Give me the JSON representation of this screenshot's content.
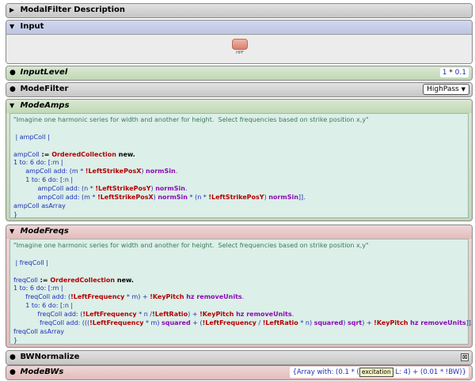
{
  "panels": {
    "description": {
      "title": "ModalFilter Description"
    },
    "input": {
      "title": "Input",
      "node_label": "HPF"
    },
    "input_level": {
      "title": "InputLevel",
      "value_a": "1",
      "op": "*",
      "value_b": "0.1"
    },
    "mode_filter": {
      "title": "ModeFilter",
      "selected": "HighPass"
    },
    "mode_amps": {
      "title": "ModeAmps",
      "lines": [
        [
          {
            "t": "\"Imagine one harmonic series for width and another for height.  Select frequencies based on strike position x,y\"",
            "c": "cmt"
          }
        ],
        [],
        [
          {
            "t": " | ampColl |",
            "c": "blue"
          }
        ],
        [],
        [
          {
            "t": "ampColl",
            "c": "blue"
          },
          {
            "t": " := ",
            "c": "black"
          },
          {
            "t": "OrderedCollection",
            "c": "red"
          },
          {
            "t": " new.",
            "c": "black"
          }
        ],
        [
          {
            "t": "1 to: 6 do: [",
            "c": "blue"
          },
          {
            "t": ":m",
            "c": "blue"
          },
          {
            "t": " |",
            "c": "blue"
          }
        ],
        [
          {
            "t": "      ampColl add: (m * ",
            "c": "blue"
          },
          {
            "t": "!LeftStrikePosX",
            "c": "red"
          },
          {
            "t": ") ",
            "c": "blue"
          },
          {
            "t": "normSin",
            "c": "purple"
          },
          {
            "t": ".",
            "c": "blue"
          }
        ],
        [
          {
            "t": "      1 to: 6 do: [:n |",
            "c": "blue"
          }
        ],
        [
          {
            "t": "            ampColl add: (n * ",
            "c": "blue"
          },
          {
            "t": "!LeftStrikePosY",
            "c": "red"
          },
          {
            "t": ") ",
            "c": "blue"
          },
          {
            "t": "normSin",
            "c": "purple"
          },
          {
            "t": ".",
            "c": "blue"
          }
        ],
        [
          {
            "t": "            ampColl add: (m * ",
            "c": "blue"
          },
          {
            "t": "!LeftStrikePosX",
            "c": "red"
          },
          {
            "t": ") ",
            "c": "blue"
          },
          {
            "t": "normSin",
            "c": "purple"
          },
          {
            "t": " * (n * ",
            "c": "blue"
          },
          {
            "t": "!LeftStrikePosY",
            "c": "red"
          },
          {
            "t": ") ",
            "c": "blue"
          },
          {
            "t": "normSin",
            "c": "purple"
          },
          {
            "t": "]].",
            "c": "blue"
          }
        ],
        [
          {
            "t": "ampColl asArray",
            "c": "blue"
          }
        ],
        [
          {
            "t": "}",
            "c": "blue"
          }
        ]
      ]
    },
    "mode_freqs": {
      "title": "ModeFreqs",
      "lines": [
        [
          {
            "t": "\"Imagine one harmonic series for width and another for height.  Select frequencies based on strike position x,y\"",
            "c": "cmt"
          }
        ],
        [],
        [
          {
            "t": " | freqColl |",
            "c": "blue"
          }
        ],
        [],
        [
          {
            "t": "freqColl",
            "c": "blue"
          },
          {
            "t": " := ",
            "c": "black"
          },
          {
            "t": "OrderedCollection",
            "c": "red"
          },
          {
            "t": " new.",
            "c": "black"
          }
        ],
        [
          {
            "t": "1 to: 6 do: [:m |",
            "c": "blue"
          }
        ],
        [
          {
            "t": "      freqColl add: (",
            "c": "blue"
          },
          {
            "t": "!LeftFrequency",
            "c": "red"
          },
          {
            "t": " * m) + ",
            "c": "blue"
          },
          {
            "t": "!KeyPitch",
            "c": "red"
          },
          {
            "t": " hz removeUnits",
            "c": "purple"
          },
          {
            "t": ".",
            "c": "blue"
          }
        ],
        [
          {
            "t": "      1 to: 6 do: [:n |",
            "c": "blue"
          }
        ],
        [
          {
            "t": "            freqColl add: (",
            "c": "blue"
          },
          {
            "t": "!LeftFrequency",
            "c": "red"
          },
          {
            "t": " * n /",
            "c": "blue"
          },
          {
            "t": "!LeftRatio",
            "c": "red"
          },
          {
            "t": ") + ",
            "c": "blue"
          },
          {
            "t": "!KeyPitch",
            "c": "red"
          },
          {
            "t": " hz removeUnits",
            "c": "purple"
          },
          {
            "t": ".",
            "c": "blue"
          }
        ],
        [
          {
            "t": "             freqColl add: (((",
            "c": "blue"
          },
          {
            "t": "!LeftFrequency",
            "c": "red"
          },
          {
            "t": " * m) ",
            "c": "blue"
          },
          {
            "t": "squared",
            "c": "purple"
          },
          {
            "t": " + (",
            "c": "blue"
          },
          {
            "t": "!LeftFrequency",
            "c": "red"
          },
          {
            "t": " / ",
            "c": "blue"
          },
          {
            "t": "!LeftRatio",
            "c": "red"
          },
          {
            "t": " * n) ",
            "c": "blue"
          },
          {
            "t": "squared",
            "c": "purple"
          },
          {
            "t": ") ",
            "c": "blue"
          },
          {
            "t": "sqrt",
            "c": "purple"
          },
          {
            "t": ") + ",
            "c": "blue"
          },
          {
            "t": "!KeyPitch",
            "c": "red"
          },
          {
            "t": " hz removeUnits",
            "c": "purple"
          },
          {
            "t": "]].",
            "c": "blue"
          }
        ],
        [
          {
            "t": "freqColl asArray",
            "c": "blue"
          }
        ],
        [
          {
            "t": "}",
            "c": "blue"
          }
        ]
      ]
    },
    "bw_normalize": {
      "title": "BWNormalize",
      "checkbox": "⊠"
    },
    "mode_bws": {
      "title": "ModeBWs",
      "expr_prefix": "{Array with: (0.1 * (",
      "badge": "excitation",
      "expr_suffix": " L: 4) + (0.01 * !BW)}"
    }
  },
  "colors": {
    "gray": "#d0d0d0",
    "blue": "#c4cce8",
    "green": "#cbdec0",
    "red": "#e8c6c6",
    "code_bg": "#dcefe8"
  }
}
